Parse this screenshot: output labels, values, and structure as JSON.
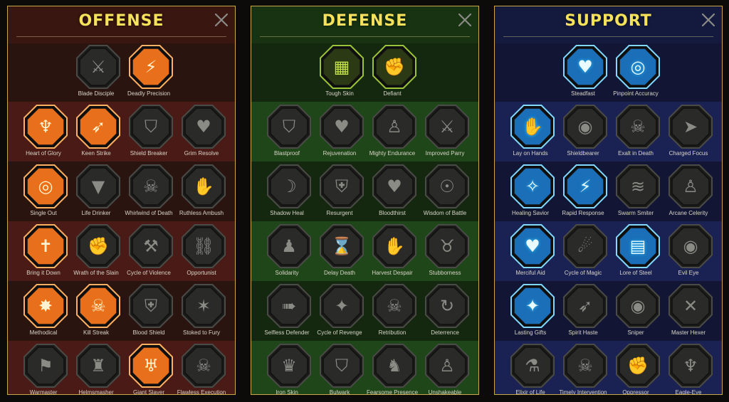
{
  "panels": [
    {
      "key": "offense",
      "title": "OFFENSE",
      "close_glyph": "✕",
      "colors": {
        "bg_top": "#3a1610",
        "bg": "#2a1410",
        "band": "#4a1a16",
        "active_fill": "#e8701c",
        "active_rim": "#ffb060"
      },
      "rows": [
        [
          {
            "name": "Blade Disciple",
            "icon": "crossed-swords-icon",
            "glyph": "⚔",
            "active": false
          },
          {
            "name": "Deadly Precision",
            "icon": "slash-streaks-icon",
            "glyph": "⚡",
            "active": true
          }
        ],
        [
          {
            "name": "Heart of Glory",
            "icon": "horned-warrior-icon",
            "glyph": "♆",
            "active": true
          },
          {
            "name": "Keen Strike",
            "icon": "piercing-arrows-icon",
            "glyph": "➶",
            "active": true
          },
          {
            "name": "Shield Breaker",
            "icon": "broken-shield-icon",
            "glyph": "⛉",
            "active": false
          },
          {
            "name": "Grim Resolve",
            "icon": "dark-heart-icon",
            "glyph": "♥",
            "active": false
          }
        ],
        [
          {
            "name": "Single Out",
            "icon": "targeted-figure-icon",
            "glyph": "◎",
            "active": true
          },
          {
            "name": "Life Drinker",
            "icon": "fanged-maw-icon",
            "glyph": "▼",
            "active": false
          },
          {
            "name": "Whirlwind of Death",
            "icon": "skull-whirl-icon",
            "glyph": "☠",
            "active": false
          },
          {
            "name": "Ruthless Ambush",
            "icon": "dagger-hand-icon",
            "glyph": "✋",
            "active": false
          }
        ],
        [
          {
            "name": "Bring it Down",
            "icon": "falling-sword-icon",
            "glyph": "✝",
            "active": true
          },
          {
            "name": "Wrath of the Slain",
            "icon": "raised-fist-icon",
            "glyph": "✊",
            "active": false
          },
          {
            "name": "Cycle of Violence",
            "icon": "axe-icon",
            "glyph": "⚒",
            "active": false
          },
          {
            "name": "Opportunist",
            "icon": "chains-icon",
            "glyph": "⛓",
            "active": false
          }
        ],
        [
          {
            "name": "Methodical",
            "icon": "arrow-burst-icon",
            "glyph": "✸",
            "active": true
          },
          {
            "name": "Kill Streak",
            "icon": "skull-icon",
            "glyph": "☠",
            "active": true
          },
          {
            "name": "Blood Shield",
            "icon": "bloody-shield-icon",
            "glyph": "⛨",
            "active": false
          },
          {
            "name": "Stoked to Fury",
            "icon": "furious-figure-icon",
            "glyph": "✶",
            "active": false
          }
        ],
        [
          {
            "name": "Warmaster",
            "icon": "warmaster-icon",
            "glyph": "⚑",
            "active": false
          },
          {
            "name": "Helmsmasher",
            "icon": "helmet-icon",
            "glyph": "♜",
            "active": false
          },
          {
            "name": "Giant Slayer",
            "icon": "giant-demon-icon",
            "glyph": "♅",
            "active": true
          },
          {
            "name": "Flawless Execution",
            "icon": "execution-skull-icon",
            "glyph": "☠",
            "active": false
          }
        ]
      ]
    },
    {
      "key": "defense",
      "title": "DEFENSE",
      "close_glyph": "✕",
      "colors": {
        "bg_top": "#173312",
        "bg": "#14280f",
        "band": "#1f4618",
        "active_fill": "#2b3a14",
        "active_rim": "#9cc23a"
      },
      "rows": [
        [
          {
            "name": "Tough Skin",
            "icon": "scaled-skin-icon",
            "glyph": "▦",
            "active": true
          },
          {
            "name": "Defiant",
            "icon": "raised-fist-icon",
            "glyph": "✊",
            "active": true
          }
        ],
        [
          {
            "name": "Blastproof",
            "icon": "chevron-shield-icon",
            "glyph": "⛉",
            "active": false
          },
          {
            "name": "Rejuvenation",
            "icon": "heart-hand-icon",
            "glyph": "♥",
            "active": false
          },
          {
            "name": "Mighty Endurance",
            "icon": "muscle-figure-icon",
            "glyph": "♙",
            "active": false
          },
          {
            "name": "Improved Parry",
            "icon": "crossed-blades-icon",
            "glyph": "⚔",
            "active": false
          }
        ],
        [
          {
            "name": "Shadow Heal",
            "icon": "shadow-figure-icon",
            "glyph": "☽",
            "active": false
          },
          {
            "name": "Resurgent",
            "icon": "sword-shield-icon",
            "glyph": "⛨",
            "active": false
          },
          {
            "name": "Bloodthirst",
            "icon": "skull-heart-icon",
            "glyph": "♥",
            "active": false
          },
          {
            "name": "Wisdom of Battle",
            "icon": "halo-figure-icon",
            "glyph": "☉",
            "active": false
          }
        ],
        [
          {
            "name": "Solidarity",
            "icon": "group-icon",
            "glyph": "♟",
            "active": false
          },
          {
            "name": "Delay Death",
            "icon": "hourglass-icon",
            "glyph": "⌛",
            "active": false
          },
          {
            "name": "Harvest Despair",
            "icon": "dark-hand-icon",
            "glyph": "✋",
            "active": false
          },
          {
            "name": "Stubborness",
            "icon": "bull-icon",
            "glyph": "♉",
            "active": false
          }
        ],
        [
          {
            "name": "Selfless Defender",
            "icon": "running-figure-icon",
            "glyph": "➠",
            "active": false
          },
          {
            "name": "Cycle of Revenge",
            "icon": "drops-icon",
            "glyph": "✦",
            "active": false
          },
          {
            "name": "Retribution",
            "icon": "spiked-skull-icon",
            "glyph": "☠",
            "active": false
          },
          {
            "name": "Deterrence",
            "icon": "swoosh-icon",
            "glyph": "↻",
            "active": false
          }
        ],
        [
          {
            "name": "Iron Skin",
            "icon": "armored-figure-icon",
            "glyph": "♛",
            "active": false
          },
          {
            "name": "Bulwark",
            "icon": "winged-shield-icon",
            "glyph": "⛉",
            "active": false
          },
          {
            "name": "Fearsome Presence",
            "icon": "bearded-warrior-icon",
            "glyph": "♞",
            "active": false
          },
          {
            "name": "Unshakeable",
            "icon": "flexing-figure-icon",
            "glyph": "♙",
            "active": false
          }
        ]
      ]
    },
    {
      "key": "support",
      "title": "SUPPORT",
      "close_glyph": "✕",
      "colors": {
        "bg_top": "#141a3e",
        "bg": "#121634",
        "band": "#1a2254",
        "active_fill": "#1a6fb8",
        "active_rim": "#7fd8ff"
      },
      "rows": [
        [
          {
            "name": "Steadfast",
            "icon": "heart-plus-icon",
            "glyph": "♥",
            "active": true
          },
          {
            "name": "Pinpoint Accuracy",
            "icon": "target-arrow-icon",
            "glyph": "◎",
            "active": true
          }
        ],
        [
          {
            "name": "Lay on Hands",
            "icon": "praying-hands-icon",
            "glyph": "✋",
            "active": true
          },
          {
            "name": "Shieldbearer",
            "icon": "round-shield-icon",
            "glyph": "◉",
            "active": false
          },
          {
            "name": "Exalt in Death",
            "icon": "flaming-skull-icon",
            "glyph": "☠",
            "active": false
          },
          {
            "name": "Charged Focus",
            "icon": "charging-figure-icon",
            "glyph": "➤",
            "active": false
          }
        ],
        [
          {
            "name": "Healing Savior",
            "icon": "sparkle-figure-icon",
            "glyph": "✧",
            "active": true
          },
          {
            "name": "Rapid Response",
            "icon": "lightning-icon",
            "glyph": "⚡",
            "active": true
          },
          {
            "name": "Swarm Smiter",
            "icon": "zigzag-icon",
            "glyph": "≋",
            "active": false
          },
          {
            "name": "Arcane Celerity",
            "icon": "fast-figure-icon",
            "glyph": "♙",
            "active": false
          }
        ],
        [
          {
            "name": "Merciful Aid",
            "icon": "chained-heart-icon",
            "glyph": "♥",
            "active": true
          },
          {
            "name": "Cycle of Magic",
            "icon": "comet-icon",
            "glyph": "☄",
            "active": false
          },
          {
            "name": "Lore of Steel",
            "icon": "book-icon",
            "glyph": "▤",
            "active": true
          },
          {
            "name": "Evil Eye",
            "icon": "evil-eyes-icon",
            "glyph": "◉",
            "active": false
          }
        ],
        [
          {
            "name": "Lasting Gifts",
            "icon": "star-compass-icon",
            "glyph": "✦",
            "active": true
          },
          {
            "name": "Spirit Haste",
            "icon": "winged-boot-icon",
            "glyph": "➶",
            "active": false
          },
          {
            "name": "Sniper",
            "icon": "eye-icon",
            "glyph": "◉",
            "active": false
          },
          {
            "name": "Master Hexer",
            "icon": "hexer-figure-icon",
            "glyph": "✕",
            "active": false
          }
        ],
        [
          {
            "name": "Elixir of Life",
            "icon": "potion-icon",
            "glyph": "⚗",
            "active": false
          },
          {
            "name": "Timely Intervention",
            "icon": "winged-skull-icon",
            "glyph": "☠",
            "active": false
          },
          {
            "name": "Oppressor",
            "icon": "fist-slam-icon",
            "glyph": "✊",
            "active": false
          },
          {
            "name": "Eagle-Eye",
            "icon": "eagle-icon",
            "glyph": "♆",
            "active": false
          }
        ]
      ]
    }
  ]
}
